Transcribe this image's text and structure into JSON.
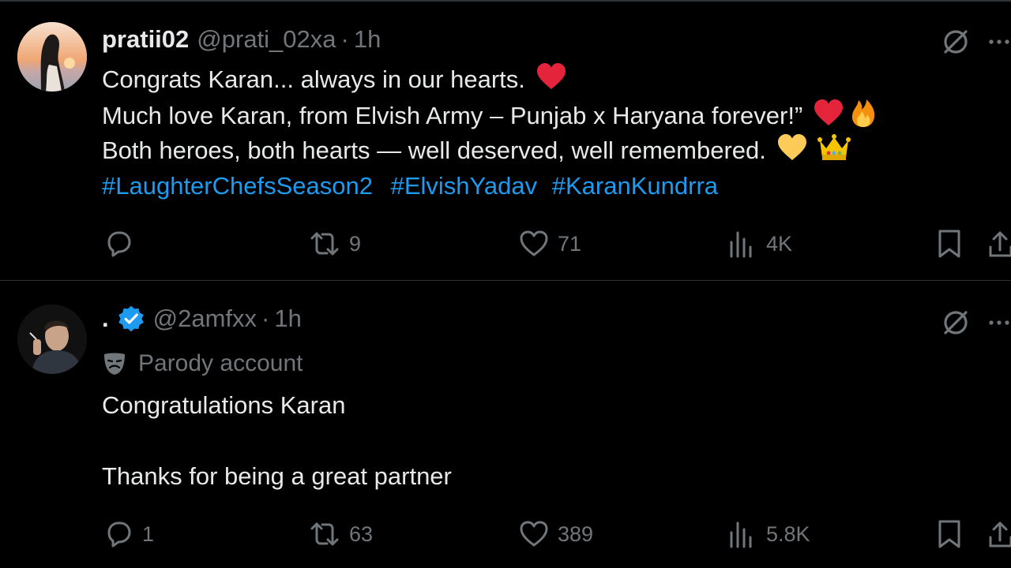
{
  "posts": [
    {
      "name": "pratii02",
      "handle": "@prati_02xa",
      "separator": "·",
      "time": "1h",
      "lines": [
        "Congrats Karan... always in our hearts.",
        "Much love Karan, from  Elvish Army – Punjab x Haryana forever!”",
        "Both heroes, both hearts — well deserved, well remembered."
      ],
      "hashtags": [
        "#LaughterChefsSeason2",
        "#ElvishYadav",
        "#KaranKundrra"
      ],
      "stats": {
        "replies": "",
        "reposts": "9",
        "likes": "71",
        "views": "4K"
      }
    },
    {
      "name": ".",
      "handle": "@2amfxx",
      "separator": "·",
      "time": "1h",
      "verified": true,
      "account_label": "Parody account",
      "lines": [
        "Congratulations Karan",
        "Thanks for being a great partner"
      ],
      "stats": {
        "replies": "1",
        "reposts": "63",
        "likes": "389",
        "views": "5.8K"
      }
    }
  ],
  "icons": {
    "reply": "reply-icon",
    "repost": "repost-icon",
    "like": "heart-icon",
    "views": "views-icon",
    "bookmark": "bookmark-icon",
    "share": "share-icon",
    "grok": "grok-icon",
    "more": "more-icon",
    "verified": "verified-badge-icon",
    "parody": "theater-mask-icon"
  },
  "colors": {
    "background": "#000000",
    "text": "#e7e9ea",
    "muted": "#71767b",
    "link": "#1d9bf0",
    "verified": "#1d9bf0",
    "divider": "#2f3336"
  }
}
